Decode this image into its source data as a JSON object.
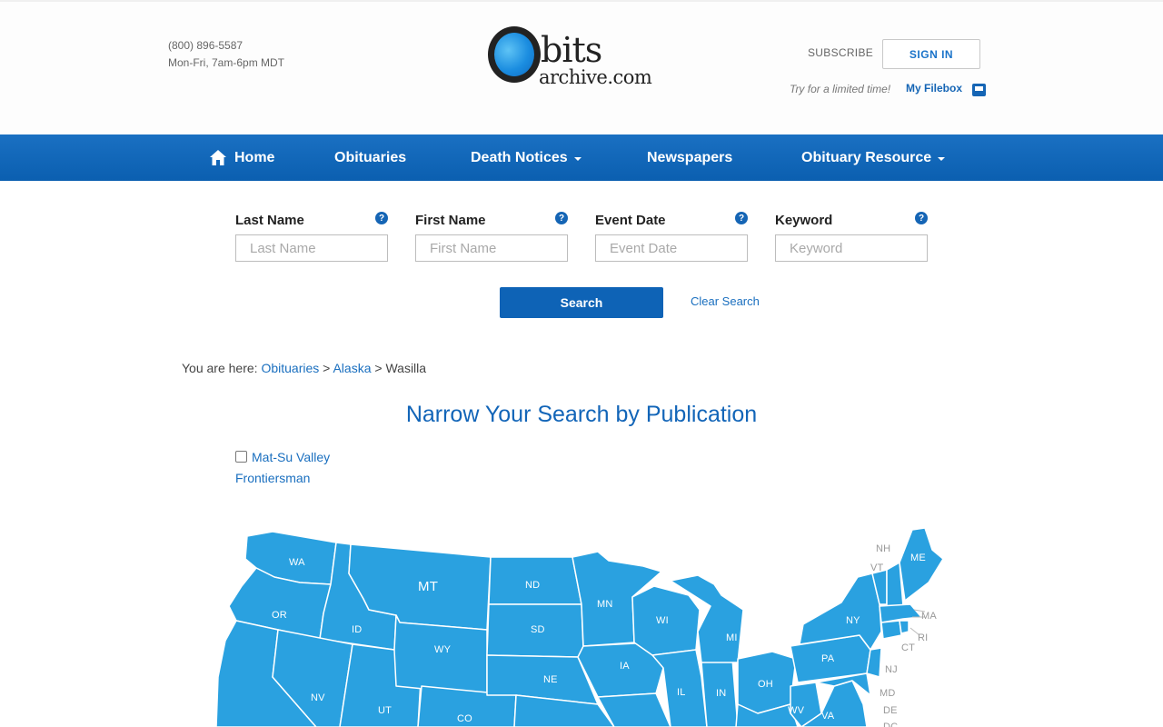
{
  "header": {
    "phone": "(800) 896-5587",
    "hours": "Mon-Fri, 7am-6pm MDT",
    "logo_main": "bits",
    "logo_sub": "archive.com",
    "subscribe_label": "SUBSCRIBE",
    "signin_label": "SIGN IN",
    "promo_text": "Try for a limited time!",
    "filebox_label": "My Filebox"
  },
  "nav": {
    "home": "Home",
    "obituaries": "Obituaries",
    "death_notices": "Death Notices",
    "newspapers": "Newspapers",
    "obituary_resource": "Obituary Resource"
  },
  "search": {
    "fields": [
      {
        "label": "Last Name",
        "placeholder": "Last Name",
        "value": ""
      },
      {
        "label": "First Name",
        "placeholder": "First Name",
        "value": ""
      },
      {
        "label": "Event Date",
        "placeholder": "Event Date",
        "value": ""
      },
      {
        "label": "Keyword",
        "placeholder": "Keyword",
        "value": ""
      }
    ],
    "help_glyph": "?",
    "search_label": "Search",
    "clear_label": "Clear Search"
  },
  "breadcrumb": {
    "prefix": "You are here:",
    "items": [
      "Obituaries",
      "Alaska",
      "Wasilla"
    ],
    "separator": ">"
  },
  "publications": {
    "title": "Narrow Your Search by Publication",
    "items": [
      {
        "label": "Mat-Su Valley Frontiersman",
        "checked": false
      }
    ]
  },
  "map": {
    "fill_color": "#2aa1e0",
    "states": [
      "WA",
      "MT",
      "ND",
      "MN",
      "OR",
      "ID",
      "SD",
      "WI",
      "MI",
      "NY",
      "WY",
      "NE",
      "IA",
      "PA",
      "NV",
      "UT",
      "CO",
      "IL",
      "IN",
      "OH",
      "WV",
      "VA",
      "ME"
    ],
    "external_labels": [
      "NH",
      "VT",
      "MA",
      "RI",
      "CT",
      "NJ",
      "MD",
      "DE",
      "DC"
    ]
  },
  "colors": {
    "nav_bg": "#0e63b6",
    "link": "#1a6fbf",
    "title": "#1265b8"
  }
}
